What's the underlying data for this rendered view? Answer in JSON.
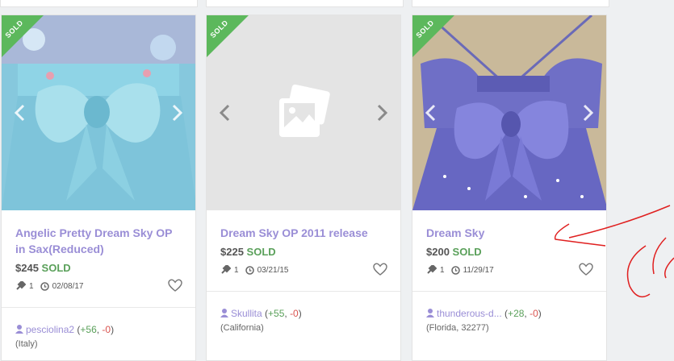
{
  "colors": {
    "accent": "#9a8ed6",
    "sold": "#5cb85c",
    "negative": "#d9534f"
  },
  "cards": [
    {
      "badge": "SOLD",
      "title": "Angelic Pretty Dream Sky OP in Sax(Reduced)",
      "price": "$245",
      "status": "SOLD",
      "bids": "1",
      "date": "02/08/17",
      "seller": "pesciolina2",
      "feedback_open": " (",
      "feedback_pos": "+56",
      "feedback_sep": ", ",
      "feedback_neg": "-0",
      "feedback_close": ")",
      "location": "(Italy)"
    },
    {
      "badge": "SOLD",
      "title": "Dream Sky OP 2011 release",
      "price": "$225",
      "status": "SOLD",
      "bids": "1",
      "date": "03/21/15",
      "seller": "Skullita",
      "feedback_open": " (",
      "feedback_pos": "+55",
      "feedback_sep": ", ",
      "feedback_neg": "-0",
      "feedback_close": ")",
      "location": "(California)"
    },
    {
      "badge": "SOLD",
      "title": "Dream Sky",
      "price": "$200",
      "status": "SOLD",
      "bids": "1",
      "date": "11/29/17",
      "seller": "thunderous-d...",
      "feedback_open": " (",
      "feedback_pos": "+28",
      "feedback_sep": ", ",
      "feedback_neg": "-0",
      "feedback_close": ")",
      "location": "(Florida, 32277)"
    }
  ]
}
